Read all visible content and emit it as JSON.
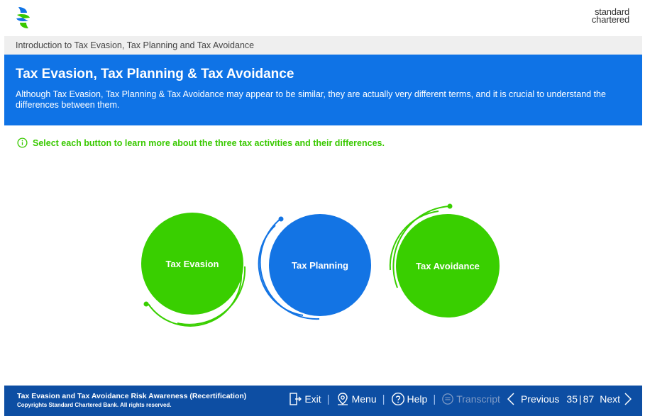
{
  "header": {
    "brand_line1": "standard",
    "brand_line2": "chartered",
    "logo_colors": [
      "#0f73e6",
      "#39c900"
    ]
  },
  "breadcrumb": "Introduction to Tax Evasion, Tax Planning and Tax Avoidance",
  "banner": {
    "title": "Tax Evasion, Tax Planning & Tax Avoidance",
    "text": "Although Tax Evasion, Tax Planning & Tax Avoidance may appear to be similar, they are actually very different terms, and it is crucial to understand the differences between them."
  },
  "instruction": "Select each button to learn more about the three tax activities and their differences.",
  "buttons": [
    {
      "label": "Tax Evasion",
      "color": "#39cf00",
      "icon": "circle-button"
    },
    {
      "label": "Tax Planning",
      "color": "#1374e4",
      "icon": "circle-button"
    },
    {
      "label": "Tax Avoidance",
      "color": "#39cf00",
      "icon": "circle-button"
    }
  ],
  "footer": {
    "course_title": "Tax Evasion and Tax Avoidance Risk Awareness (Recertification)",
    "copyright": "Copyrights Standard Chartered Bank. All rights reserved.",
    "exit": "Exit",
    "menu": "Menu",
    "help": "Help",
    "transcript": "Transcript",
    "previous": "Previous",
    "current_page": "35",
    "total_pages": "87",
    "next": "Next"
  },
  "colors": {
    "banner_bg": "#0f73e6",
    "footer_bg": "#0d4ea3",
    "accent_green": "#39c900"
  }
}
